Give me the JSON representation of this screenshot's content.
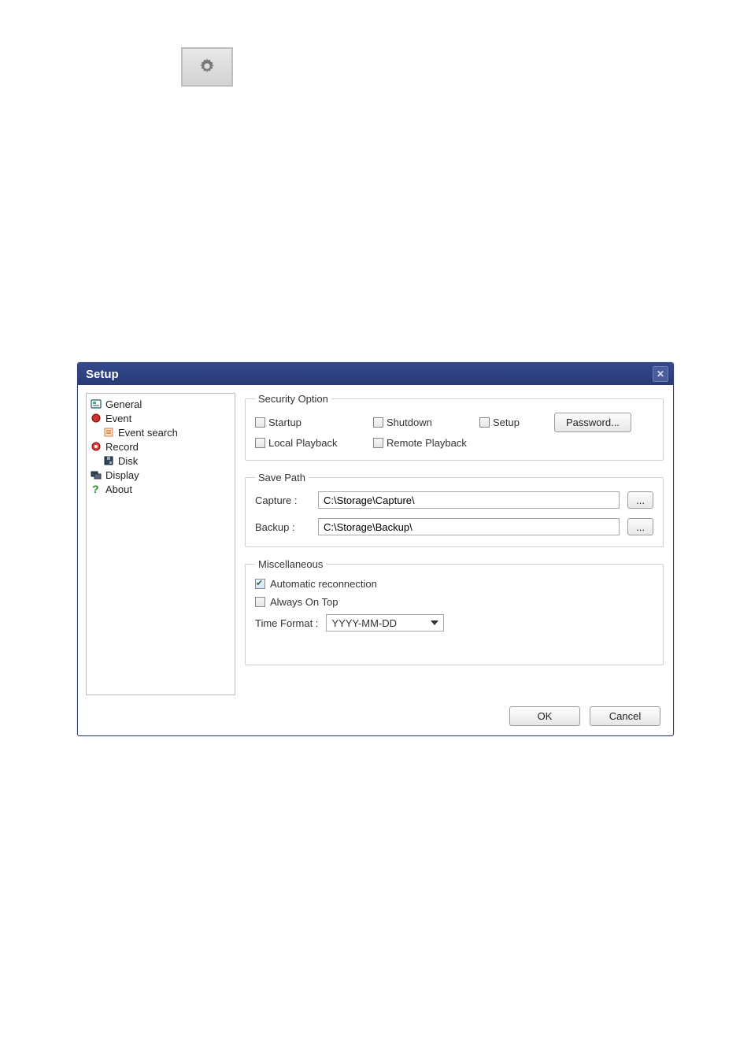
{
  "toolbar_icon_name": "settings-gear",
  "dialog": {
    "title": "Setup",
    "close_symbol": "✕",
    "tree": {
      "items": [
        {
          "key": "general",
          "label": "General",
          "indent": 0,
          "icon": "card"
        },
        {
          "key": "event",
          "label": "Event",
          "indent": 0,
          "icon": "dot-red"
        },
        {
          "key": "evsrch",
          "label": "Event search",
          "indent": 1,
          "icon": "note"
        },
        {
          "key": "record",
          "label": "Record",
          "indent": 0,
          "icon": "gear-red"
        },
        {
          "key": "disk",
          "label": "Disk",
          "indent": 1,
          "icon": "disk"
        },
        {
          "key": "display",
          "label": "Display",
          "indent": 0,
          "icon": "screens"
        },
        {
          "key": "about",
          "label": "About",
          "indent": 0,
          "icon": "qmark"
        }
      ]
    },
    "security": {
      "legend": "Security Option",
      "startup_label": "Startup",
      "shutdown_label": "Shutdown",
      "setup_label": "Setup",
      "local_pb_label": "Local Playback",
      "remote_pb_label": "Remote Playback",
      "password_btn": "Password..."
    },
    "savepath": {
      "legend": "Save Path",
      "capture_label": "Capture :",
      "capture_value": "C:\\Storage\\Capture\\",
      "backup_label": "Backup :",
      "backup_value": "C:\\Storage\\Backup\\",
      "browse_btn": "..."
    },
    "misc": {
      "legend": "Miscellaneous",
      "auto_reconn_label": "Automatic reconnection",
      "auto_reconn_checked": true,
      "always_on_top_label": "Always On Top",
      "always_on_top_checked": false,
      "time_fmt_label": "Time Format :",
      "time_fmt_value": "YYYY-MM-DD"
    },
    "ok_label": "OK",
    "cancel_label": "Cancel"
  }
}
